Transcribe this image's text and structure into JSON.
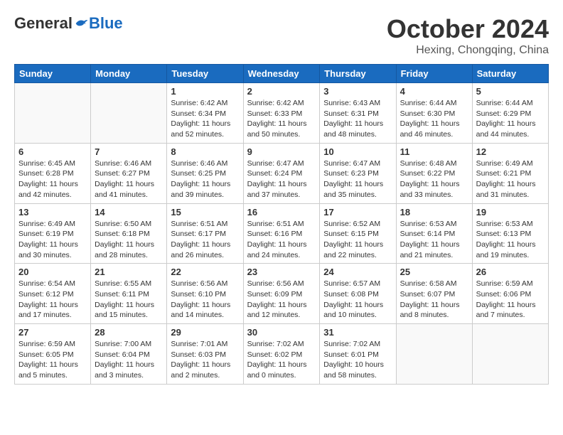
{
  "logo": {
    "general": "General",
    "blue": "Blue"
  },
  "title": "October 2024",
  "subtitle": "Hexing, Chongqing, China",
  "headers": [
    "Sunday",
    "Monday",
    "Tuesday",
    "Wednesday",
    "Thursday",
    "Friday",
    "Saturday"
  ],
  "weeks": [
    [
      {
        "day": "",
        "info": ""
      },
      {
        "day": "",
        "info": ""
      },
      {
        "day": "1",
        "info": "Sunrise: 6:42 AM\nSunset: 6:34 PM\nDaylight: 11 hours and 52 minutes."
      },
      {
        "day": "2",
        "info": "Sunrise: 6:42 AM\nSunset: 6:33 PM\nDaylight: 11 hours and 50 minutes."
      },
      {
        "day": "3",
        "info": "Sunrise: 6:43 AM\nSunset: 6:31 PM\nDaylight: 11 hours and 48 minutes."
      },
      {
        "day": "4",
        "info": "Sunrise: 6:44 AM\nSunset: 6:30 PM\nDaylight: 11 hours and 46 minutes."
      },
      {
        "day": "5",
        "info": "Sunrise: 6:44 AM\nSunset: 6:29 PM\nDaylight: 11 hours and 44 minutes."
      }
    ],
    [
      {
        "day": "6",
        "info": "Sunrise: 6:45 AM\nSunset: 6:28 PM\nDaylight: 11 hours and 42 minutes."
      },
      {
        "day": "7",
        "info": "Sunrise: 6:46 AM\nSunset: 6:27 PM\nDaylight: 11 hours and 41 minutes."
      },
      {
        "day": "8",
        "info": "Sunrise: 6:46 AM\nSunset: 6:25 PM\nDaylight: 11 hours and 39 minutes."
      },
      {
        "day": "9",
        "info": "Sunrise: 6:47 AM\nSunset: 6:24 PM\nDaylight: 11 hours and 37 minutes."
      },
      {
        "day": "10",
        "info": "Sunrise: 6:47 AM\nSunset: 6:23 PM\nDaylight: 11 hours and 35 minutes."
      },
      {
        "day": "11",
        "info": "Sunrise: 6:48 AM\nSunset: 6:22 PM\nDaylight: 11 hours and 33 minutes."
      },
      {
        "day": "12",
        "info": "Sunrise: 6:49 AM\nSunset: 6:21 PM\nDaylight: 11 hours and 31 minutes."
      }
    ],
    [
      {
        "day": "13",
        "info": "Sunrise: 6:49 AM\nSunset: 6:19 PM\nDaylight: 11 hours and 30 minutes."
      },
      {
        "day": "14",
        "info": "Sunrise: 6:50 AM\nSunset: 6:18 PM\nDaylight: 11 hours and 28 minutes."
      },
      {
        "day": "15",
        "info": "Sunrise: 6:51 AM\nSunset: 6:17 PM\nDaylight: 11 hours and 26 minutes."
      },
      {
        "day": "16",
        "info": "Sunrise: 6:51 AM\nSunset: 6:16 PM\nDaylight: 11 hours and 24 minutes."
      },
      {
        "day": "17",
        "info": "Sunrise: 6:52 AM\nSunset: 6:15 PM\nDaylight: 11 hours and 22 minutes."
      },
      {
        "day": "18",
        "info": "Sunrise: 6:53 AM\nSunset: 6:14 PM\nDaylight: 11 hours and 21 minutes."
      },
      {
        "day": "19",
        "info": "Sunrise: 6:53 AM\nSunset: 6:13 PM\nDaylight: 11 hours and 19 minutes."
      }
    ],
    [
      {
        "day": "20",
        "info": "Sunrise: 6:54 AM\nSunset: 6:12 PM\nDaylight: 11 hours and 17 minutes."
      },
      {
        "day": "21",
        "info": "Sunrise: 6:55 AM\nSunset: 6:11 PM\nDaylight: 11 hours and 15 minutes."
      },
      {
        "day": "22",
        "info": "Sunrise: 6:56 AM\nSunset: 6:10 PM\nDaylight: 11 hours and 14 minutes."
      },
      {
        "day": "23",
        "info": "Sunrise: 6:56 AM\nSunset: 6:09 PM\nDaylight: 11 hours and 12 minutes."
      },
      {
        "day": "24",
        "info": "Sunrise: 6:57 AM\nSunset: 6:08 PM\nDaylight: 11 hours and 10 minutes."
      },
      {
        "day": "25",
        "info": "Sunrise: 6:58 AM\nSunset: 6:07 PM\nDaylight: 11 hours and 8 minutes."
      },
      {
        "day": "26",
        "info": "Sunrise: 6:59 AM\nSunset: 6:06 PM\nDaylight: 11 hours and 7 minutes."
      }
    ],
    [
      {
        "day": "27",
        "info": "Sunrise: 6:59 AM\nSunset: 6:05 PM\nDaylight: 11 hours and 5 minutes."
      },
      {
        "day": "28",
        "info": "Sunrise: 7:00 AM\nSunset: 6:04 PM\nDaylight: 11 hours and 3 minutes."
      },
      {
        "day": "29",
        "info": "Sunrise: 7:01 AM\nSunset: 6:03 PM\nDaylight: 11 hours and 2 minutes."
      },
      {
        "day": "30",
        "info": "Sunrise: 7:02 AM\nSunset: 6:02 PM\nDaylight: 11 hours and 0 minutes."
      },
      {
        "day": "31",
        "info": "Sunrise: 7:02 AM\nSunset: 6:01 PM\nDaylight: 10 hours and 58 minutes."
      },
      {
        "day": "",
        "info": ""
      },
      {
        "day": "",
        "info": ""
      }
    ]
  ]
}
